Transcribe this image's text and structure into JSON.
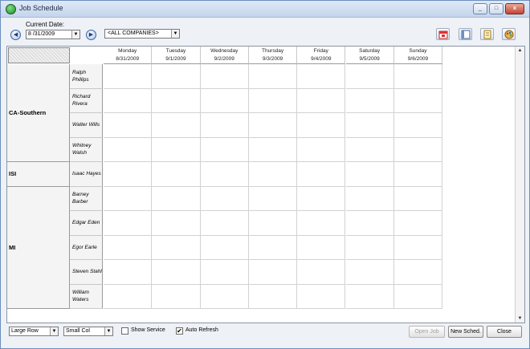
{
  "window": {
    "title": "Job Schedule",
    "min": "_",
    "max": "□",
    "close": "x"
  },
  "toolbar": {
    "current_date_label": "Current Date:",
    "date_value": "8 /31/2009",
    "company_value": "<ALL COMPANIES>",
    "prev_glyph": "◀",
    "next_glyph": "▶",
    "dropdown_glyph": "▼",
    "icons": [
      "calendar-icon",
      "layout-icon",
      "report-icon",
      "palette-icon"
    ]
  },
  "schedule": {
    "days": [
      {
        "name": "Monday",
        "date": "8/31/2009"
      },
      {
        "name": "Tuesday",
        "date": "9/1/2009"
      },
      {
        "name": "Wednesday",
        "date": "9/2/2009"
      },
      {
        "name": "Thursday",
        "date": "9/3/2009"
      },
      {
        "name": "Friday",
        "date": "9/4/2009"
      },
      {
        "name": "Saturday",
        "date": "9/5/2009"
      },
      {
        "name": "Sunday",
        "date": "9/6/2009"
      }
    ],
    "groups": [
      {
        "name": "CA-Southern",
        "people": [
          "Ralph Phillips",
          "Richard Rivera",
          "Walter Wills",
          "Whitney Walsh"
        ]
      },
      {
        "name": "ISI",
        "people": [
          "Isaac Hayes"
        ]
      },
      {
        "name": "MI",
        "people": [
          "Barney Barber",
          "Edgar Eden",
          "Egor Earle",
          "Steven Stahl",
          "William Waters"
        ]
      }
    ]
  },
  "footer": {
    "row_size": "Large Row",
    "col_size": "Small Col",
    "show_service_label": "Show Service",
    "show_service_checked": false,
    "auto_refresh_label": "Auto Refresh",
    "auto_refresh_checked": true,
    "check_glyph": "✔",
    "open_job_label": "Open Job",
    "new_sched_label": "New Sched.",
    "close_label": "Close"
  }
}
